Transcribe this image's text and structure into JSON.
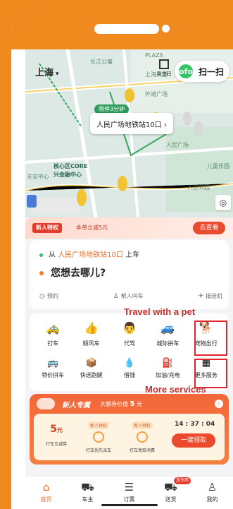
{
  "map": {
    "city": "上海",
    "scan_label": "扫一扫",
    "qr_label": "乘车码",
    "pickup_tag": "限停3分钟",
    "pickup_point": "人民广场地铁站10口 ›",
    "labels": [
      "长江公寓",
      "PLAZA",
      "上海大厦",
      "外滩广场",
      "人民广场",
      "人民公园",
      "核心区CORE",
      "兴金融中心",
      "天安中心",
      "儿童乐园"
    ]
  },
  "promo": {
    "badge": "新人特权",
    "text": "本单立减5元",
    "button": "去查看"
  },
  "route": {
    "from_prefix": "从",
    "from_place": "人民广场地铁站10口",
    "from_suffix": "上车",
    "to_prompt": "您想去哪儿?",
    "options": [
      {
        "icon": "clock-icon",
        "label": "预约"
      },
      {
        "icon": "person-icon",
        "label": "帮人叫车"
      },
      {
        "icon": "plane-icon",
        "label": "接送机"
      }
    ]
  },
  "services": [
    {
      "icon": "taxi-icon",
      "glyph": "🚕",
      "label": "打车"
    },
    {
      "icon": "thumb-icon",
      "glyph": "👍",
      "label": "顺风车"
    },
    {
      "icon": "driver-icon",
      "glyph": "👨",
      "label": "代驾"
    },
    {
      "icon": "carpool-icon",
      "glyph": "🚙",
      "label": "城际拼车"
    },
    {
      "icon": "pet-icon",
      "glyph": "🐕",
      "label": "宠物出行"
    },
    {
      "icon": "bus-icon",
      "glyph": "🚌",
      "label": "特价拼车"
    },
    {
      "icon": "courier-icon",
      "glyph": "📦",
      "label": "快送跑腿"
    },
    {
      "icon": "money-icon",
      "glyph": "💧",
      "label": "借钱"
    },
    {
      "icon": "fuel-icon",
      "glyph": "⛽",
      "label": "加油/充电"
    },
    {
      "icon": "more-icon",
      "glyph": "▦",
      "label": "更多服务"
    }
  ],
  "annotations": {
    "pet": "Travel with a pet",
    "more": "More services"
  },
  "vip": {
    "title": "新人专属",
    "subtitle_prefix": "大额券价值",
    "subtitle_value": "5",
    "subtitle_unit": "元",
    "coupons": [
      {
        "tag": "",
        "value": "5",
        "unit": "元",
        "caption": "打车立减券"
      },
      {
        "tag": "新人特权",
        "value": "",
        "unit": "",
        "caption": "打车优先派车"
      },
      {
        "tag": "新人特权",
        "value": "",
        "unit": "",
        "caption": "打车免取消费"
      }
    ],
    "timer": "14 : 37 : 04",
    "claim": "一键领取"
  },
  "tabs": [
    {
      "icon": "home-icon",
      "glyph": "⌂",
      "label": "首页",
      "active": true
    },
    {
      "icon": "car-owner-icon",
      "glyph": "⛟",
      "label": "车主"
    },
    {
      "icon": "order-icon",
      "glyph": "☰",
      "label": "订票"
    },
    {
      "icon": "delivery-icon",
      "glyph": "⛟",
      "label": "送货",
      "badge": "送东西"
    },
    {
      "icon": "profile-icon",
      "glyph": "♙",
      "label": "我的"
    }
  ],
  "colors": {
    "brand_orange": "#f08a1e",
    "accent": "#e96a24",
    "highlight_red": "#e0262b"
  }
}
